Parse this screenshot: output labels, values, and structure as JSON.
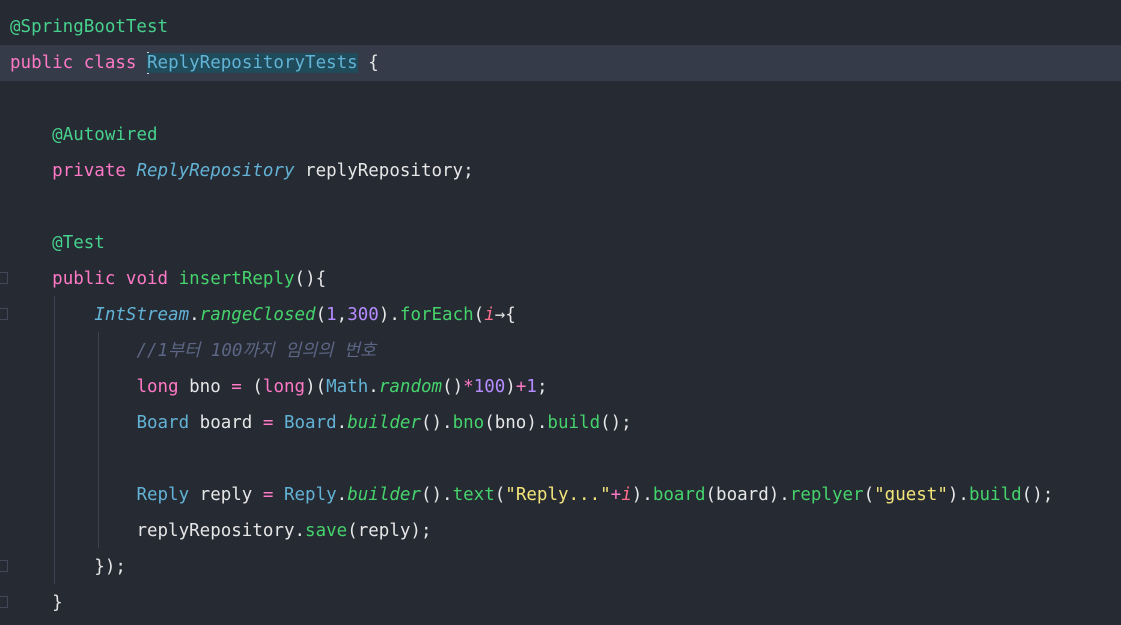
{
  "code": {
    "lines": [
      {
        "tokens": [
          {
            "t": "@SpringBootTest",
            "c": "ann"
          }
        ]
      },
      {
        "current": true,
        "tokens": [
          {
            "t": "public",
            "c": "kw"
          },
          {
            "t": " ",
            "c": "plain"
          },
          {
            "t": "class",
            "c": "kw"
          },
          {
            "t": " ",
            "c": "plain"
          },
          {
            "t": "ReplyRepositoryTests",
            "c": "cls sel-word",
            "caret": true
          },
          {
            "t": " {",
            "c": "plain"
          }
        ]
      },
      {
        "tokens": []
      },
      {
        "tokens": [
          {
            "t": "    ",
            "c": "plain"
          },
          {
            "t": "@Autowired",
            "c": "ann"
          }
        ]
      },
      {
        "tokens": [
          {
            "t": "    ",
            "c": "plain"
          },
          {
            "t": "private",
            "c": "kw"
          },
          {
            "t": " ",
            "c": "plain"
          },
          {
            "t": "ReplyRepository",
            "c": "clsi"
          },
          {
            "t": " replyRepository;",
            "c": "plain"
          }
        ]
      },
      {
        "tokens": []
      },
      {
        "tokens": [
          {
            "t": "    ",
            "c": "plain"
          },
          {
            "t": "@Test",
            "c": "ann"
          }
        ]
      },
      {
        "tokens": [
          {
            "t": "    ",
            "c": "plain"
          },
          {
            "t": "public",
            "c": "kw"
          },
          {
            "t": " ",
            "c": "plain"
          },
          {
            "t": "void",
            "c": "kw"
          },
          {
            "t": " ",
            "c": "plain"
          },
          {
            "t": "insertReply",
            "c": "fn"
          },
          {
            "t": "(){",
            "c": "plain"
          }
        ]
      },
      {
        "tokens": [
          {
            "t": "        ",
            "c": "plain"
          },
          {
            "t": "IntStream",
            "c": "clsi"
          },
          {
            "t": ".",
            "c": "plain"
          },
          {
            "t": "rangeClosed",
            "c": "fni"
          },
          {
            "t": "(",
            "c": "plain"
          },
          {
            "t": "1",
            "c": "num"
          },
          {
            "t": ",",
            "c": "plain"
          },
          {
            "t": "300",
            "c": "num"
          },
          {
            "t": ").",
            "c": "plain"
          },
          {
            "t": "forEach",
            "c": "fn"
          },
          {
            "t": "(",
            "c": "plain"
          },
          {
            "t": "i",
            "c": "param"
          },
          {
            "t": "→{",
            "c": "plain"
          }
        ]
      },
      {
        "tokens": [
          {
            "t": "            ",
            "c": "plain"
          },
          {
            "t": "//1부터 100까지 임의의 번호",
            "c": "cmt"
          }
        ]
      },
      {
        "tokens": [
          {
            "t": "            ",
            "c": "plain"
          },
          {
            "t": "long",
            "c": "kw"
          },
          {
            "t": " bno ",
            "c": "plain"
          },
          {
            "t": "=",
            "c": "op"
          },
          {
            "t": " (",
            "c": "plain"
          },
          {
            "t": "long",
            "c": "kw"
          },
          {
            "t": ")(",
            "c": "plain"
          },
          {
            "t": "Math",
            "c": "cls"
          },
          {
            "t": ".",
            "c": "plain"
          },
          {
            "t": "random",
            "c": "fni"
          },
          {
            "t": "()",
            "c": "plain"
          },
          {
            "t": "*",
            "c": "op"
          },
          {
            "t": "100",
            "c": "num"
          },
          {
            "t": ")",
            "c": "plain"
          },
          {
            "t": "+",
            "c": "op"
          },
          {
            "t": "1",
            "c": "num"
          },
          {
            "t": ";",
            "c": "plain"
          }
        ]
      },
      {
        "tokens": [
          {
            "t": "            ",
            "c": "plain"
          },
          {
            "t": "Board",
            "c": "cls"
          },
          {
            "t": " board ",
            "c": "plain"
          },
          {
            "t": "=",
            "c": "op"
          },
          {
            "t": " ",
            "c": "plain"
          },
          {
            "t": "Board",
            "c": "cls"
          },
          {
            "t": ".",
            "c": "plain"
          },
          {
            "t": "builder",
            "c": "fni"
          },
          {
            "t": "().",
            "c": "plain"
          },
          {
            "t": "bno",
            "c": "fn"
          },
          {
            "t": "(bno).",
            "c": "plain"
          },
          {
            "t": "build",
            "c": "fn"
          },
          {
            "t": "();",
            "c": "plain"
          }
        ]
      },
      {
        "tokens": []
      },
      {
        "tokens": [
          {
            "t": "            ",
            "c": "plain"
          },
          {
            "t": "Reply",
            "c": "cls"
          },
          {
            "t": " reply ",
            "c": "plain"
          },
          {
            "t": "=",
            "c": "op"
          },
          {
            "t": " ",
            "c": "plain"
          },
          {
            "t": "Reply",
            "c": "cls"
          },
          {
            "t": ".",
            "c": "plain"
          },
          {
            "t": "builder",
            "c": "fni"
          },
          {
            "t": "().",
            "c": "plain"
          },
          {
            "t": "text",
            "c": "fn"
          },
          {
            "t": "(",
            "c": "plain"
          },
          {
            "t": "\"Reply...\"",
            "c": "str"
          },
          {
            "t": "+",
            "c": "op"
          },
          {
            "t": "i",
            "c": "param"
          },
          {
            "t": ").",
            "c": "plain"
          },
          {
            "t": "board",
            "c": "fn"
          },
          {
            "t": "(board).",
            "c": "plain"
          },
          {
            "t": "replyer",
            "c": "fn"
          },
          {
            "t": "(",
            "c": "plain"
          },
          {
            "t": "\"guest\"",
            "c": "str"
          },
          {
            "t": ").",
            "c": "plain"
          },
          {
            "t": "build",
            "c": "fn"
          },
          {
            "t": "();",
            "c": "plain"
          }
        ]
      },
      {
        "tokens": [
          {
            "t": "            ",
            "c": "plain"
          },
          {
            "t": "replyRepository",
            "c": "plain"
          },
          {
            "t": ".",
            "c": "plain"
          },
          {
            "t": "save",
            "c": "fn"
          },
          {
            "t": "(reply);",
            "c": "plain"
          }
        ]
      },
      {
        "tokens": [
          {
            "t": "        ",
            "c": "plain"
          },
          {
            "t": "});",
            "c": "plain"
          }
        ]
      },
      {
        "tokens": [
          {
            "t": "    ",
            "c": "plain"
          },
          {
            "t": "}",
            "c": "plain"
          }
        ]
      }
    ]
  }
}
